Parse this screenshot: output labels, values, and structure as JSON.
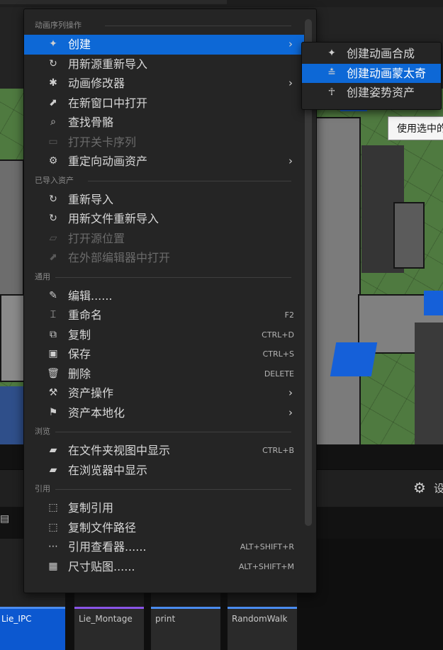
{
  "tooltip": "使用选中的",
  "toolbar": {
    "settings_label": "设"
  },
  "assets": [
    {
      "name": "Lie_IPC"
    },
    {
      "name": "Lie_Montage"
    },
    {
      "name": "print"
    },
    {
      "name": "RandomWalk"
    }
  ],
  "menu": {
    "sections": {
      "anim": "动画序列操作",
      "imported": "已导入资产",
      "common": "通用",
      "browse": "浏览",
      "refs": "引用"
    },
    "items": {
      "create": "创建",
      "reimport_new_source": "用新源重新导入",
      "anim_modifiers": "动画修改器",
      "open_new_window": "在新窗口中打开",
      "find_skeleton": "查找骨骼",
      "open_level_sequence": "打开关卡序列",
      "retarget": "重定向动画资产",
      "reimport": "重新导入",
      "reimport_new_file": "用新文件重新导入",
      "open_source_location": "打开源位置",
      "open_external_editor": "在外部编辑器中打开",
      "edit": "编辑......",
      "rename": "重命名",
      "duplicate": "复制",
      "save": "保存",
      "delete": "删除",
      "asset_actions": "资产操作",
      "asset_localization": "资产本地化",
      "show_in_folder": "在文件夹视图中显示",
      "show_in_browser": "在浏览器中显示",
      "copy_reference": "复制引用",
      "copy_file_path": "复制文件路径",
      "reference_viewer": "引用查看器......",
      "size_map": "尺寸贴图......"
    },
    "shortcuts": {
      "rename": "F2",
      "duplicate": "CTRL+D",
      "save": "CTRL+S",
      "delete": "DELETE",
      "show_in_folder": "CTRL+B",
      "reference_viewer": "ALT+SHIFT+R",
      "size_map": "ALT+SHIFT+M"
    }
  },
  "submenu": {
    "create_composite": "创建动画合成",
    "create_montage": "创建动画蒙太奇",
    "create_pose_asset": "创建姿势资产"
  },
  "colors": {
    "highlight": "#0d68d6",
    "menu_bg": "#252525",
    "ground": "#4f7a40",
    "block_blue": "#1560d9"
  }
}
